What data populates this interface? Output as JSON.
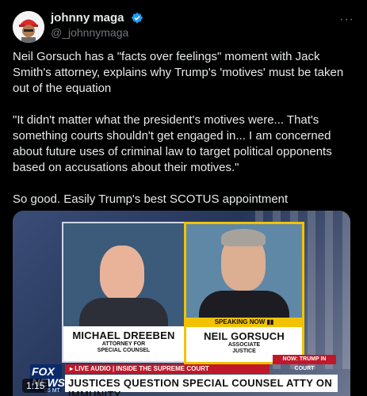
{
  "author": {
    "name": "johnny maga",
    "handle": "@_johnnymaga",
    "avatar_icon": "avatar-icon",
    "verified_icon": "verified-badge-icon",
    "colors": {
      "verified": "#1d9bf0",
      "cap": "#d82b2b"
    }
  },
  "menu": {
    "more_label": "···"
  },
  "tweet_text": {
    "p1": "Neil Gorsuch has a \"facts over feelings\" moment with Jack Smith's attorney, explains why Trump's 'motives' must be taken out of the equation",
    "p2": "\"It didn't matter what the president's motives were... That's something courts shouldn't get engaged in... I am concerned about future uses of criminal law to target political opponents based on accusations about their motives.\"",
    "p3": "So good. Easily Trump's best SCOTUS appointment"
  },
  "video": {
    "left_person": {
      "name": "MICHAEL DREEBEN",
      "title_line1": "ATTORNEY FOR",
      "title_line2": "SPECIAL COUNSEL"
    },
    "right_person": {
      "name": "NEIL GORSUCH",
      "title_line1": "ASSOCIATE",
      "title_line2": "JUSTICE",
      "speaking_label": "SPEAKING NOW"
    },
    "now_label": "NOW: TRUMP IN COURT",
    "live_audio": "LIVE AUDIO | INSIDE THE SUPREME COURT",
    "headline": "JUSTICES QUESTION SPECIAL COUNSEL ATTY ON IMMUNITY",
    "network": {
      "line1": "FOX",
      "line2": "NEWS",
      "sub": "05 MT"
    },
    "timestamp": "1:15"
  }
}
